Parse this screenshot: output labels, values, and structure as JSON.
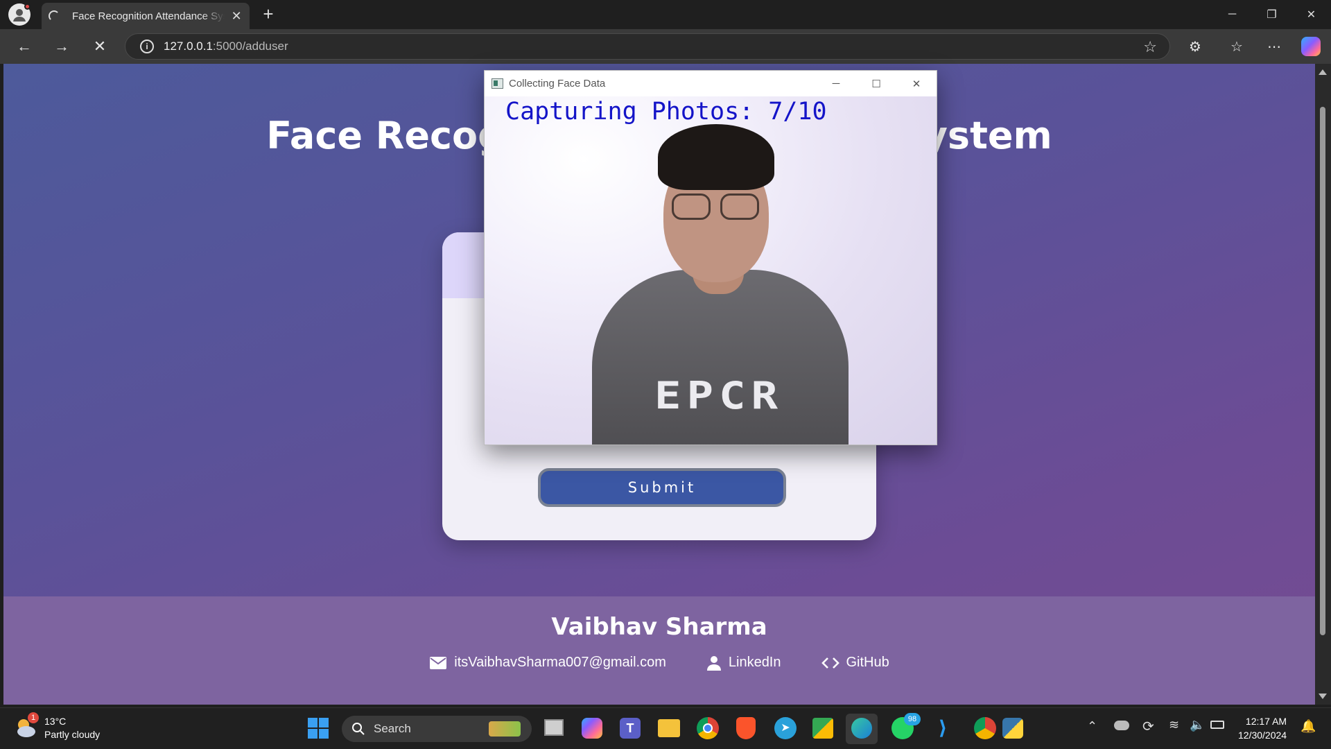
{
  "browser": {
    "tab_title": "Face Recognition Attendance System",
    "address_host": "127.0.0.1",
    "address_path": ":5000/adduser"
  },
  "page": {
    "title": "Face Recognition Attendance System",
    "submit_label": "Submit",
    "footer": {
      "name": "Vaibhav Sharma",
      "email": "itsVaibhavSharma007@gmail.com",
      "linkedin": "LinkedIn",
      "github": "GitHub"
    }
  },
  "capture_window": {
    "title": "Collecting Face Data",
    "overlay_text": "Capturing Photos: 7/10",
    "progress_current": 7,
    "progress_total": 10,
    "shirt_logo": "EPCR"
  },
  "taskbar": {
    "weather_temp": "13°C",
    "weather_desc": "Partly cloudy",
    "weather_badge": "1",
    "search_label": "Search",
    "whatsapp_badge": "98",
    "time": "12:17 AM",
    "date": "12/30/2024"
  },
  "colors": {
    "page_gradient_start": "#4d5a9b",
    "page_gradient_end": "#754b92",
    "submit_bg": "#3b57a4",
    "overlay_text": "#1414c8"
  }
}
